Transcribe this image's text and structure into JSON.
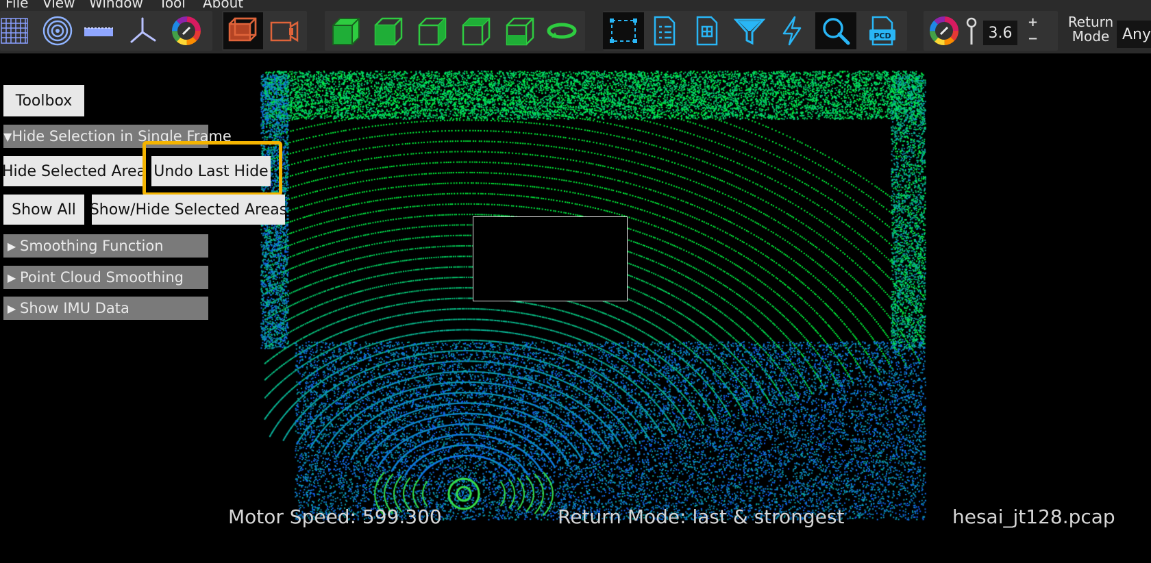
{
  "menu": [
    "File",
    "View",
    "Window",
    "Tool",
    "About"
  ],
  "toolbar": {
    "point_size": "3.6",
    "plus": "+",
    "minus": "−",
    "return_mode_label": "Return\nMode",
    "return_mode_value": "Any",
    "pcd_label": "PCD"
  },
  "sidebar": {
    "toolbox": "Toolbox",
    "hide_section": "Hide Selection in Single Frame",
    "hide_selected_area": "Hide Selected Area",
    "undo_last_hide": "Undo Last Hide",
    "show_all": "Show All",
    "show_hide_selected_areas": "Show/Hide Selected Areas",
    "smoothing_function": "Smoothing Function",
    "point_cloud_smoothing": "Point Cloud Smoothing",
    "show_imu_data": "Show IMU Data"
  },
  "status": {
    "motor_speed": "Motor Speed:   599.300",
    "return_mode": "Return Mode: last & strongest",
    "file_name": "hesai_jt128.pcap"
  },
  "colors": {
    "accent_highlight": "#f4b400",
    "cube_green": "#2ecc40",
    "icon_cyan": "#29b6f6"
  }
}
